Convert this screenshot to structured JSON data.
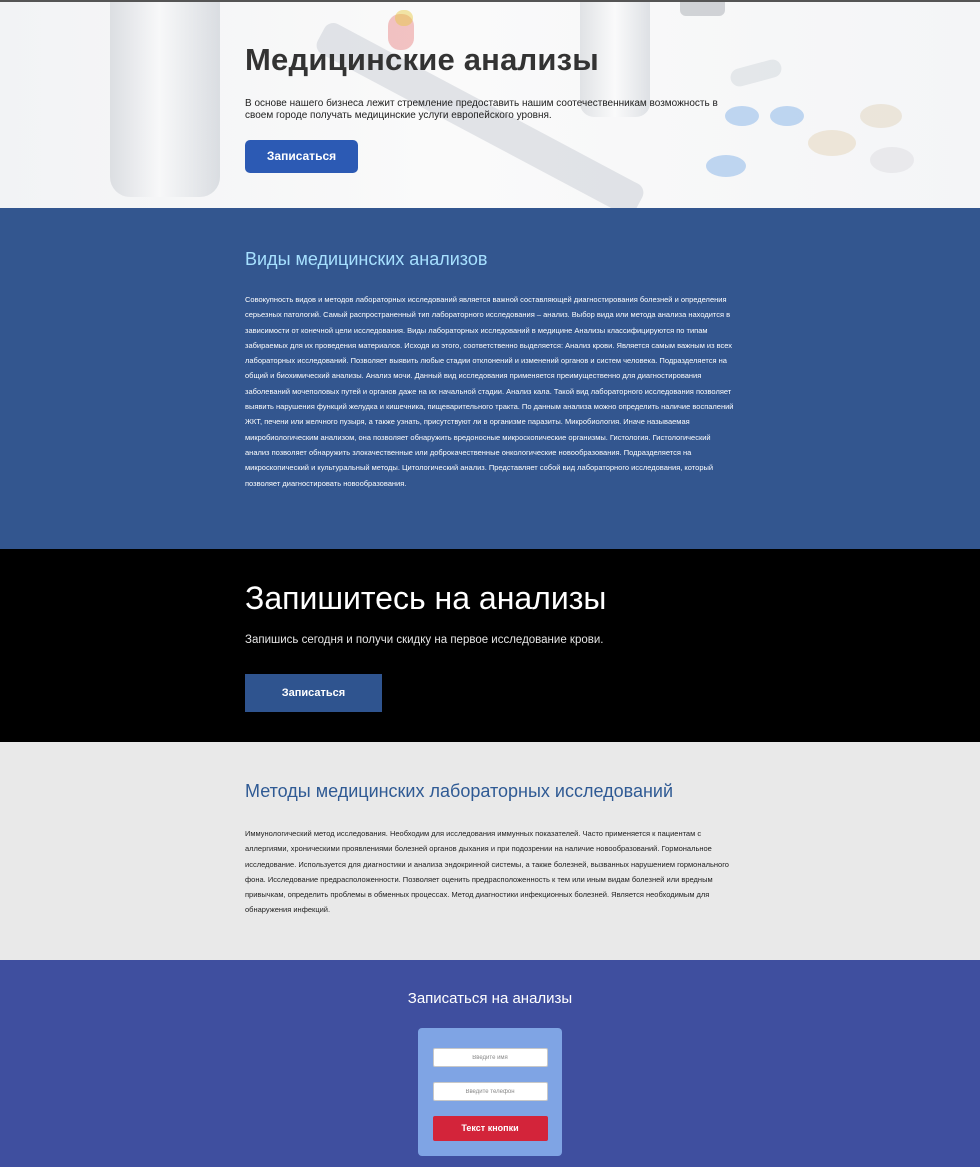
{
  "hero": {
    "title": "Медицинские анализы",
    "text": "В основе нашего бизнеса лежит стремление предоставить нашим соотечественникам возможность в своем городе получать медицинские услуги европейского уровня.",
    "button_label": "Записаться"
  },
  "types": {
    "title": "Виды медицинских анализов",
    "text": "Совокупность видов и методов лабораторных исследований является важной составляющей диагностирования болезней и определения серьезных патологий. Самый распространенный тип лабораторного исследования – анализ. Выбор вида или метода анализа находится в зависимости от конечной цели исследования. Виды лабораторных исследований в медицине Анализы классифицируются по типам забираемых для их проведения материалов. Исходя из этого, соответственно выделяется: Анализ крови. Является самым важным из всех лабораторных исследований. Позволяет выявить любые стадии отклонений и изменений органов и систем человека. Подразделяется на общий и биохимический анализы. Анализ мочи. Данный вид исследования применяется преимущественно для диагностирования заболеваний мочеполовых путей и органов даже на их начальной стадии. Анализ кала. Такой вид лабораторного исследования позволяет выявить нарушения функций желудка и кишечника, пищеварительного тракта. По данным анализа можно определить наличие воспалений ЖКТ, печени или желчного пузыря, а также узнать, присутствуют ли в организме паразиты. Микробиология. Иначе называемая микробиологическим анализом, она позволяет обнаружить вредоносные микроскопические организмы. Гистология. Гистологический анализ позволяет обнаружить злокачественные или доброкачественные онкологические новообразования. Подразделяется на микроскопический и культуральный методы. Цитологический анализ. Представляет собой вид лабораторного исследования, который позволяет диагностировать новообразования."
  },
  "cta": {
    "title": "Запишитесь на анализы",
    "text": "Запишись сегодня и получи скидку на первое исследование крови.",
    "button_label": "Записаться"
  },
  "methods": {
    "title": "Методы медицинских лабораторных исследований",
    "text": "Иммунологический метод исследования. Необходим для исследования иммунных показателей. Часто применяется к пациентам с аллергиями, хроническими проявлениями болезней органов дыхания и при подозрении на наличие новообразований. Гормональное исследование. Используется для диагностики и анализа эндокринной системы, а также болезней, вызванных нарушением гормонального фона. Исследование предрасположенности. Позволяет оценить предрасположенность к тем или иным видам болезней или вредным привычкам, определить проблемы в обменных процессах. Метод диагностики инфекционных болезней. Является необходимым для обнаружения инфекций."
  },
  "signup": {
    "title": "Записаться на анализы",
    "name_placeholder": "Введите имя",
    "phone_placeholder": "Введите телефон",
    "button_label": "Текст кнопки"
  },
  "colors": {
    "hero_button": "#2c5ab4",
    "types_bg": "#33568f",
    "types_title": "#a6e0ff",
    "cta_bg": "#000000",
    "methods_bg": "#e9e9e9",
    "methods_title": "#2f5a94",
    "signup_bg": "#3f4f9f",
    "form_card": "#7fa4e4",
    "form_button": "#d3243a"
  }
}
